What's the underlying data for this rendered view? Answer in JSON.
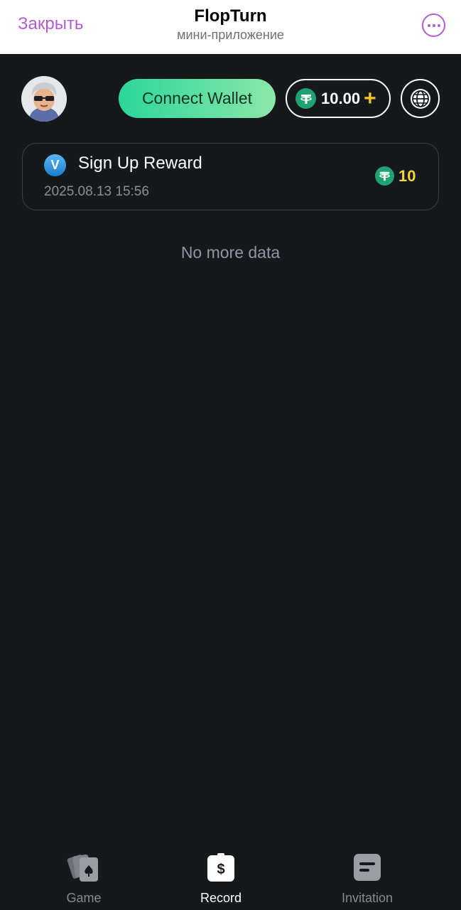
{
  "topbar": {
    "close_label": "Закрыть",
    "title": "FlopTurn",
    "subtitle": "мини-приложение"
  },
  "header": {
    "connect_wallet_label": "Connect Wallet",
    "balance": "10.00"
  },
  "records": [
    {
      "title": "Sign Up Reward",
      "date": "2025.08.13 15:56",
      "amount": "10"
    }
  ],
  "empty_text": "No more data",
  "nav": {
    "game_label": "Game",
    "record_label": "Record",
    "invitation_label": "Invitation",
    "active": "record"
  },
  "colors": {
    "accent_purple": "#b35bd6",
    "wallet_gradient_start": "#2bd69a",
    "wallet_gradient_end": "#8be7a9",
    "tether_green": "#20a172",
    "amount_yellow": "#f6d43a",
    "background": "#16191c"
  }
}
